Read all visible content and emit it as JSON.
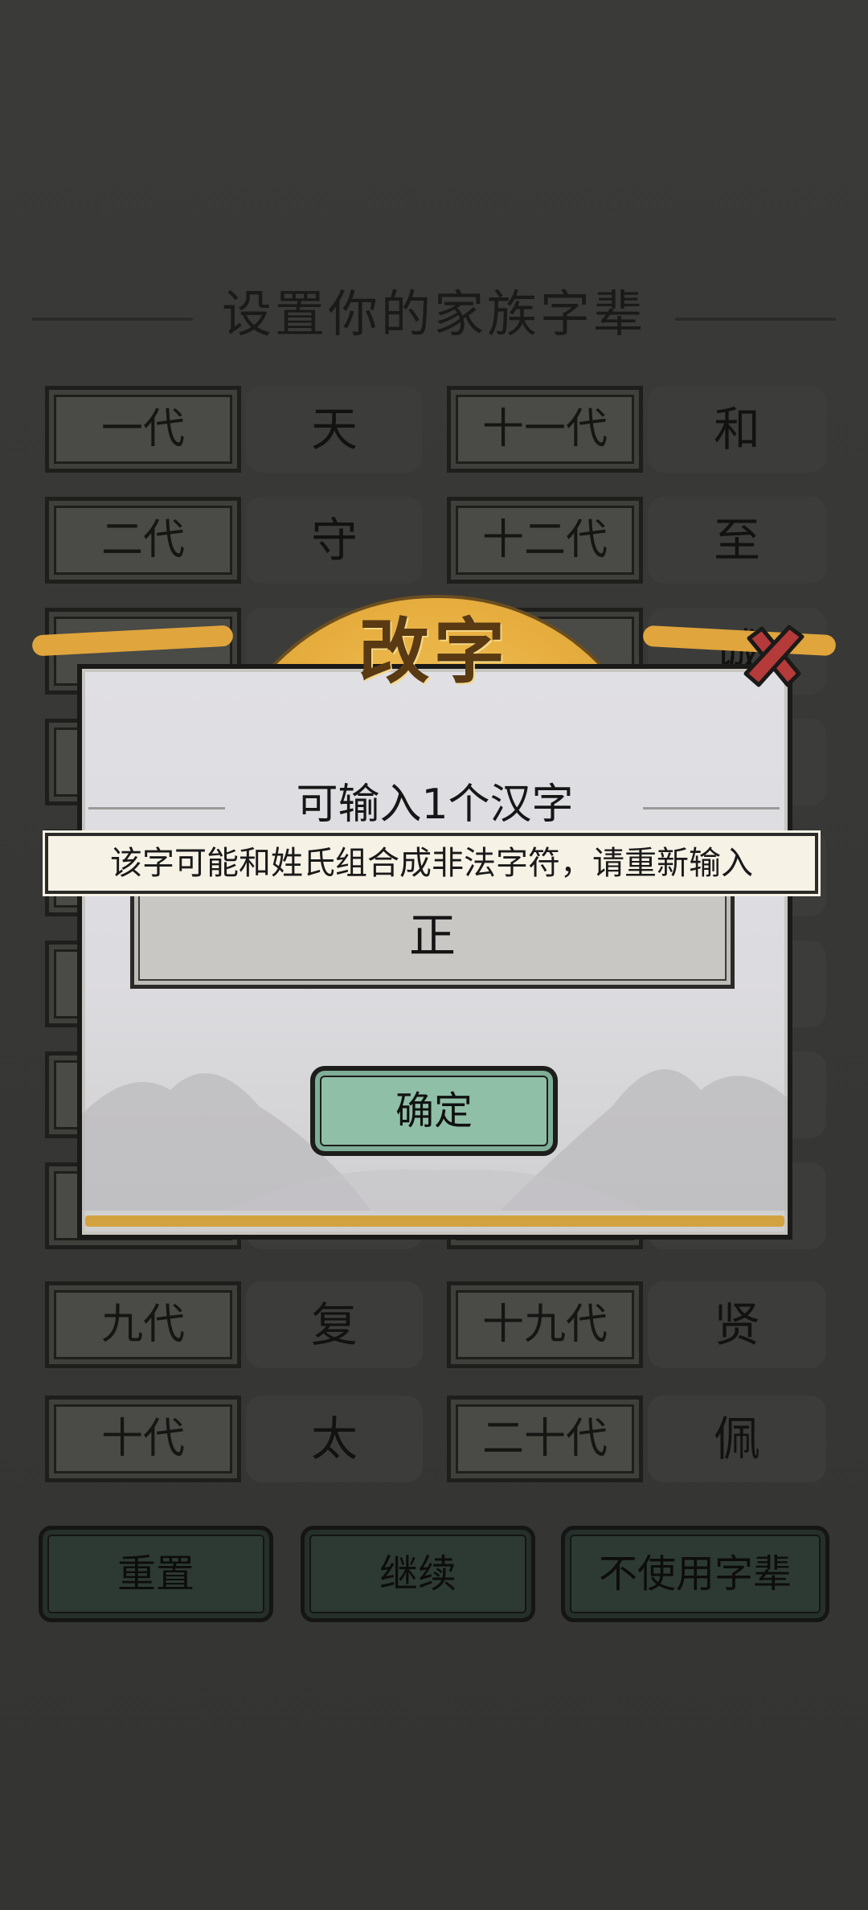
{
  "page": {
    "title": "设置你的家族字辈",
    "left_rows": [
      {
        "gen": "一代",
        "char": "天"
      },
      {
        "gen": "二代",
        "char": "守"
      },
      {
        "gen": "",
        "char": ""
      },
      {
        "gen": "",
        "char": ""
      },
      {
        "gen": "",
        "char": ""
      },
      {
        "gen": "",
        "char": ""
      },
      {
        "gen": "",
        "char": ""
      },
      {
        "gen": "",
        "char": ""
      },
      {
        "gen": "九代",
        "char": "复"
      },
      {
        "gen": "十代",
        "char": "太"
      }
    ],
    "right_rows": [
      {
        "gen": "十一代",
        "char": "和"
      },
      {
        "gen": "十二代",
        "char": "至"
      },
      {
        "gen": "",
        "char": "诚"
      },
      {
        "gen": "",
        "char": ""
      },
      {
        "gen": "",
        "char": ""
      },
      {
        "gen": "",
        "char": ""
      },
      {
        "gen": "",
        "char": ""
      },
      {
        "gen": "",
        "char": ""
      },
      {
        "gen": "十九代",
        "char": "贤"
      },
      {
        "gen": "二十代",
        "char": "佩"
      }
    ],
    "buttons": {
      "reset": "重置",
      "continue": "继续",
      "no_generation": "不使用字辈"
    }
  },
  "dialog": {
    "title": "改字",
    "hint": "可输入1个汉字",
    "input_value": "正",
    "confirm_label": "确定"
  },
  "toast": {
    "message": "该字可能和姓氏组合成非法字符，请重新输入"
  },
  "colors": {
    "overlay": "#2f2f2f",
    "gold": "#e7ae3f",
    "confirm_green": "#8fbfa7",
    "close_red": "#b53a3a"
  }
}
